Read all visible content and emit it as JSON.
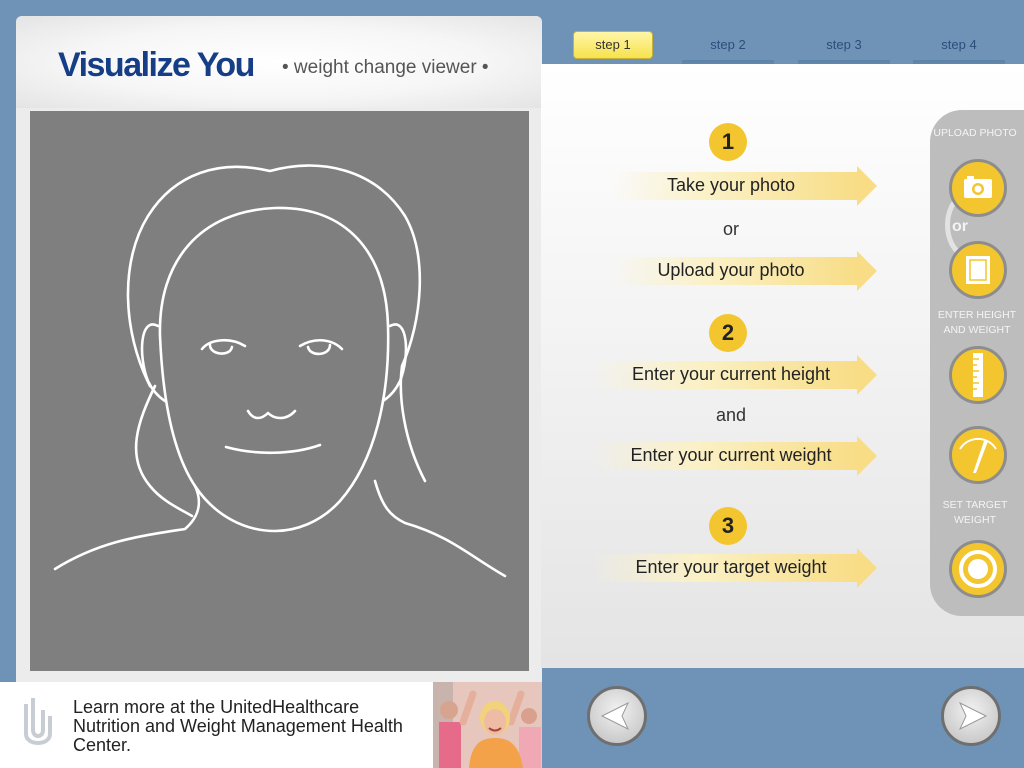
{
  "app": {
    "title": "Visualize You",
    "subtitle": "• weight change viewer •"
  },
  "tabs": [
    {
      "label": "step 1",
      "active": true
    },
    {
      "label": "step 2",
      "active": false
    },
    {
      "label": "step 3",
      "active": false
    },
    {
      "label": "step 4",
      "active": false
    }
  ],
  "steps": {
    "step1": {
      "number": "1",
      "take_photo": "Take your photo",
      "or": "or",
      "upload_photo": "Upload your photo"
    },
    "step2": {
      "number": "2",
      "current_height": "Enter your current height",
      "and": "and",
      "current_weight": "Enter your current weight"
    },
    "step3": {
      "number": "3",
      "target_weight": "Enter your target weight"
    }
  },
  "tool_rail": {
    "upload_photo_label": "UPLOAD PHOTO",
    "or_label": "or",
    "height_weight_label": "ENTER HEIGHT AND WEIGHT",
    "target_weight_label": "SET TARGET WEIGHT",
    "icons": [
      "camera-icon",
      "photo-frame-icon",
      "ruler-icon",
      "scale-dial-icon",
      "target-icon"
    ]
  },
  "ad": {
    "text": "Learn more at the UnitedHealthcare Nutrition and Weight Management Health Center."
  },
  "colors": {
    "brand_blue": "#163e87",
    "accent_yellow": "#f3c62f",
    "background_blue": "#6f93b7",
    "photo_gray": "#7f7f7f"
  }
}
